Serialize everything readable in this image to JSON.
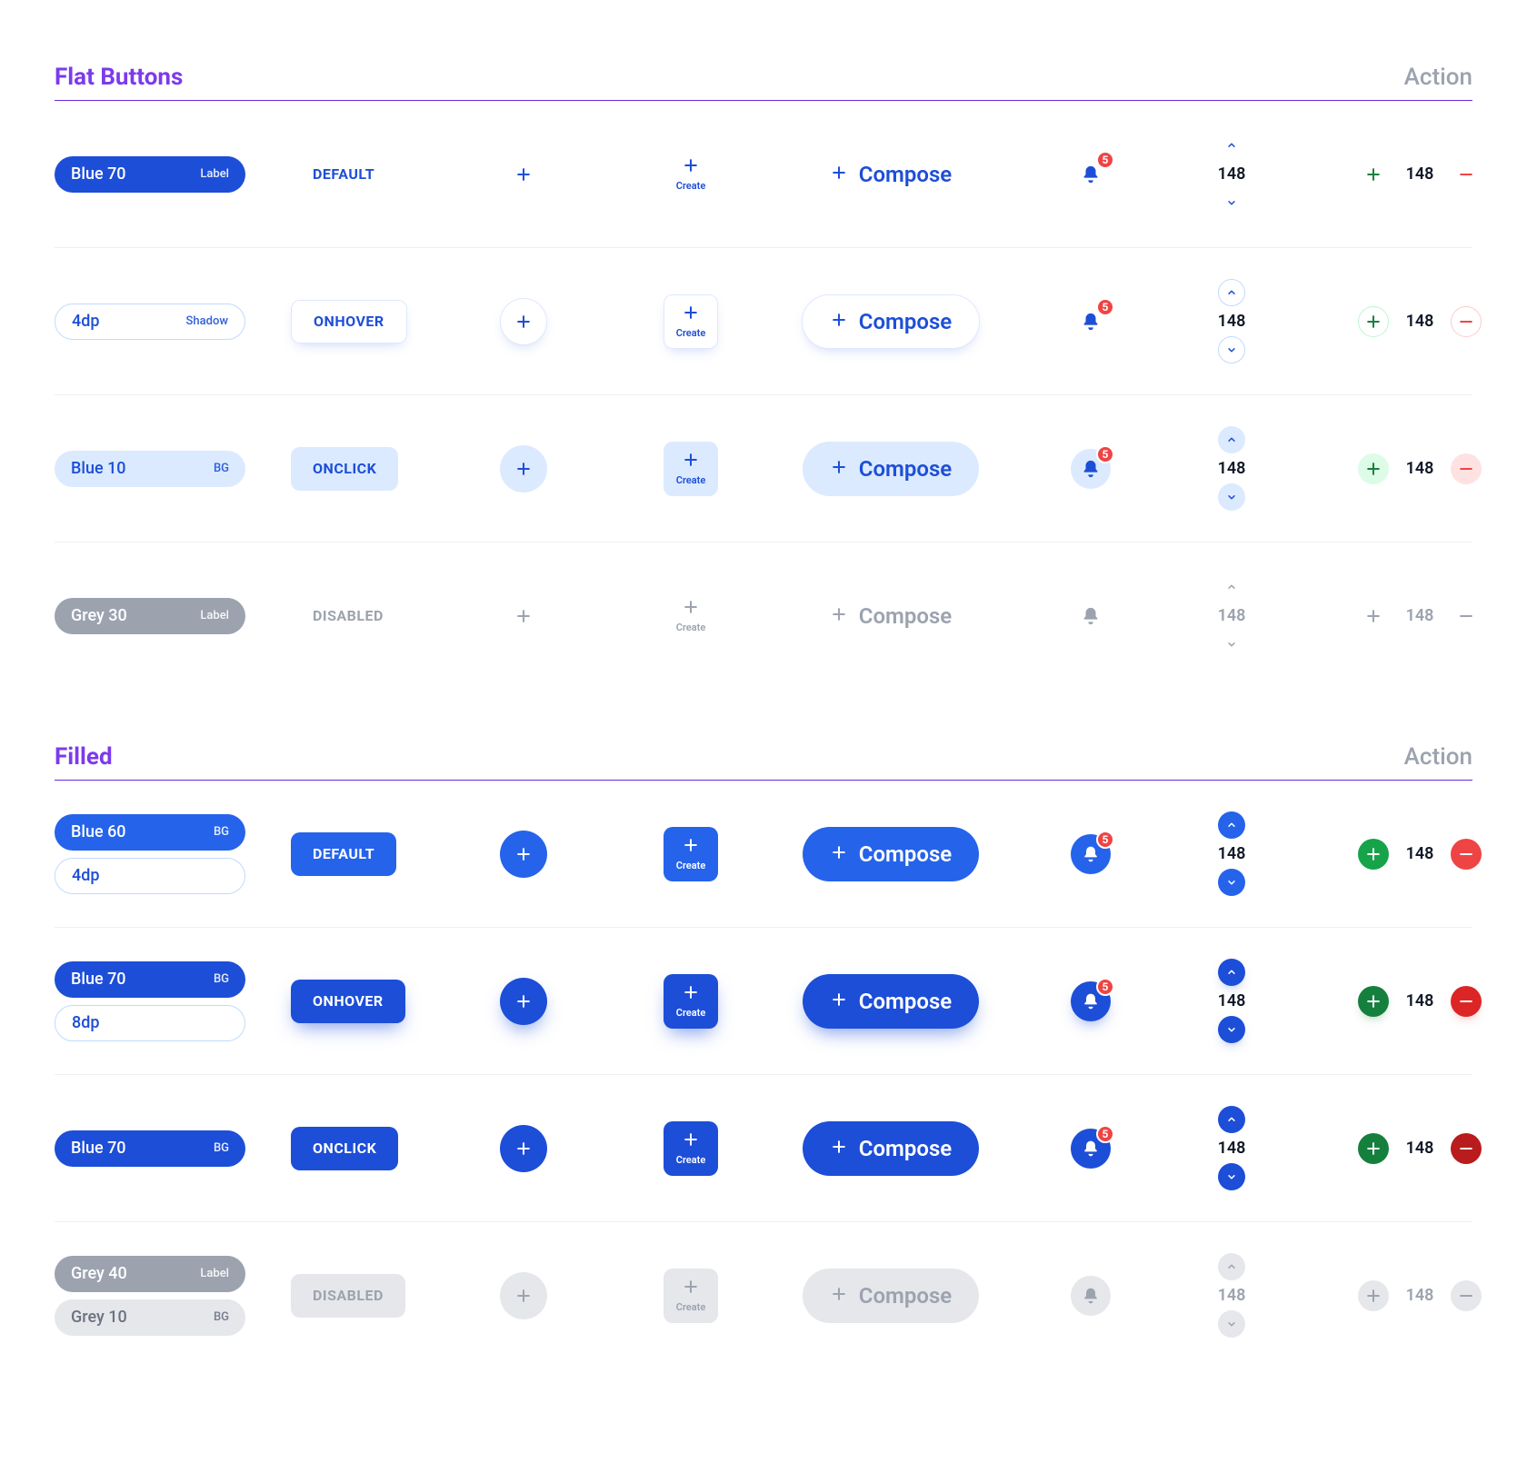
{
  "labels": {
    "action": "Action",
    "compose": "Compose",
    "create": "Create",
    "default": "DEFAULT",
    "onhover": "ONHOVER",
    "onclick": "ONCLICK",
    "disabled": "DISABLED"
  },
  "sections": {
    "flat": {
      "title": "Flat Buttons",
      "rows": [
        {
          "state": "default",
          "chips": [
            {
              "text": "Blue 70",
              "tag": "Label"
            }
          ],
          "stepper_value": "148",
          "badge": "5",
          "stepper_h_value": "148"
        },
        {
          "state": "onhover",
          "chips": [
            {
              "text": "4dp",
              "tag": "Shadow"
            }
          ],
          "stepper_value": "148",
          "badge": "5",
          "stepper_h_value": "148"
        },
        {
          "state": "onclick",
          "chips": [
            {
              "text": "Blue 10",
              "tag": "BG"
            }
          ],
          "stepper_value": "148",
          "badge": "5",
          "stepper_h_value": "148"
        },
        {
          "state": "disabled",
          "chips": [
            {
              "text": "Grey 30",
              "tag": "Label"
            }
          ],
          "stepper_value": "148",
          "badge": "",
          "stepper_h_value": "148"
        }
      ]
    },
    "filled": {
      "title": "Filled",
      "rows": [
        {
          "state": "default",
          "chips": [
            {
              "text": "Blue 60",
              "tag": "BG"
            },
            {
              "text": "4dp",
              "tag": ""
            }
          ],
          "stepper_value": "148",
          "badge": "5",
          "stepper_h_value": "148"
        },
        {
          "state": "onhover",
          "chips": [
            {
              "text": "Blue 70",
              "tag": "BG"
            },
            {
              "text": "8dp",
              "tag": ""
            }
          ],
          "stepper_value": "148",
          "badge": "5",
          "stepper_h_value": "148"
        },
        {
          "state": "onclick",
          "chips": [
            {
              "text": "Blue 70",
              "tag": "BG"
            }
          ],
          "stepper_value": "148",
          "badge": "5",
          "stepper_h_value": "148"
        },
        {
          "state": "disabled",
          "chips": [
            {
              "text": "Grey 40",
              "tag": "Label"
            },
            {
              "text": "Grey 10",
              "tag": "BG"
            }
          ],
          "stepper_value": "148",
          "badge": "",
          "stepper_h_value": "148"
        }
      ]
    }
  }
}
